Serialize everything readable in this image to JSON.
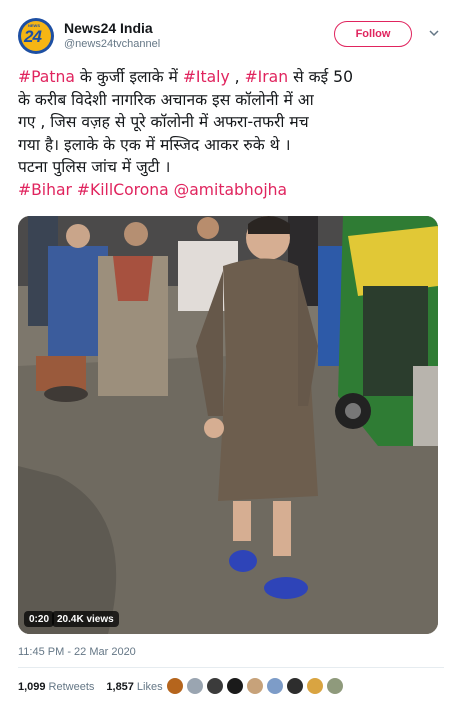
{
  "account": {
    "name": "News24 India",
    "handle": "@news24tvchannel",
    "avatar_number": "24",
    "avatar_small": "NEWS",
    "follow_label": "Follow"
  },
  "tweet": {
    "line1": [
      {
        "text": "#Patna",
        "tag": true
      },
      {
        "text": " के कुर्जी इलाके में ",
        "tag": false
      },
      {
        "text": "#Italy",
        "tag": true
      },
      {
        "text": " , ",
        "tag": false
      },
      {
        "text": "#Iran",
        "tag": true
      },
      {
        "text": "  से कई 50",
        "tag": false
      }
    ],
    "line2": "के करीब विदेशी नागरिक अचानक इस कॉलोनी में आ",
    "line3": "गए , जिस वज़ह से पूरे कॉलोनी में अफरा-तफरी मच",
    "line4": "गया है। इलाके के एक में मस्जिद आकर रुके थे ।",
    "line5": "पटना पुलिस जांच में जुटी ।",
    "line6": [
      {
        "text": "#Bihar",
        "tag": true
      },
      {
        "text": " ",
        "tag": false
      },
      {
        "text": "#KillCorona",
        "tag": true
      },
      {
        "text": " ",
        "tag": false
      },
      {
        "text": "@amitabhojha",
        "tag": true
      }
    ]
  },
  "video": {
    "duration": "0:20",
    "views": "20.4K views"
  },
  "timestamp": "11:45 PM - 22 Mar 2020",
  "stats": {
    "retweets_count": "1,099",
    "retweets_label": "Retweets",
    "likes_count": "1,857",
    "likes_label": "Likes"
  },
  "likers": [
    {
      "icon": "liker-avatar-1",
      "color": "#b5651d"
    },
    {
      "icon": "liker-avatar-2",
      "color": "#9aa5b1"
    },
    {
      "icon": "liker-avatar-3",
      "color": "#3b3b3b"
    },
    {
      "icon": "liker-avatar-4",
      "color": "#1a1a1a"
    },
    {
      "icon": "liker-avatar-5",
      "color": "#c7a27a"
    },
    {
      "icon": "liker-avatar-6",
      "color": "#7d9cc8"
    },
    {
      "icon": "liker-avatar-7",
      "color": "#2d2d2d"
    },
    {
      "icon": "liker-avatar-8",
      "color": "#d9a441"
    },
    {
      "icon": "liker-avatar-9",
      "color": "#8f9a7c"
    }
  ],
  "colors": {
    "accent": "#e0245e",
    "text": "#14171a",
    "muted": "#657786"
  }
}
